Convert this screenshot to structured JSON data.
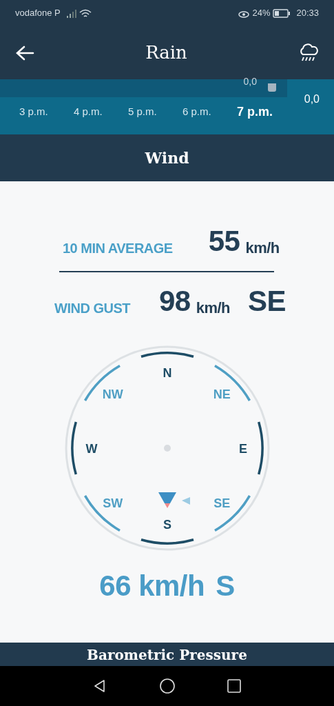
{
  "status_bar": {
    "carrier": "vodafone P",
    "battery": "24%",
    "time": "20:33"
  },
  "app_bar": {
    "title": "Rain"
  },
  "rain_strip": {
    "values": [
      "0,0",
      "0,0"
    ],
    "hours": [
      {
        "label": "3 p.m.",
        "selected": false
      },
      {
        "label": "4 p.m.",
        "selected": false
      },
      {
        "label": "5 p.m.",
        "selected": false
      },
      {
        "label": "6 p.m.",
        "selected": false
      },
      {
        "label": "7 p.m.",
        "selected": true
      }
    ]
  },
  "wind": {
    "title": "Wind",
    "average": {
      "label": "10 MIN AVERAGE",
      "value": "55",
      "unit": "km/h"
    },
    "gust": {
      "label": "WIND GUST",
      "value": "98",
      "unit": "km/h",
      "direction": "SE"
    },
    "compass": [
      {
        "label": "N",
        "kind": "cardinal"
      },
      {
        "label": "NE",
        "kind": "intercardinal"
      },
      {
        "label": "E",
        "kind": "cardinal"
      },
      {
        "label": "SE",
        "kind": "intercardinal"
      },
      {
        "label": "S",
        "kind": "cardinal"
      },
      {
        "label": "SW",
        "kind": "intercardinal"
      },
      {
        "label": "W",
        "kind": "cardinal"
      },
      {
        "label": "NW",
        "kind": "intercardinal"
      }
    ],
    "current": {
      "value": "66",
      "unit": "km/h",
      "direction": "S"
    }
  },
  "next_section": {
    "title": "Barometric Pressure"
  }
}
